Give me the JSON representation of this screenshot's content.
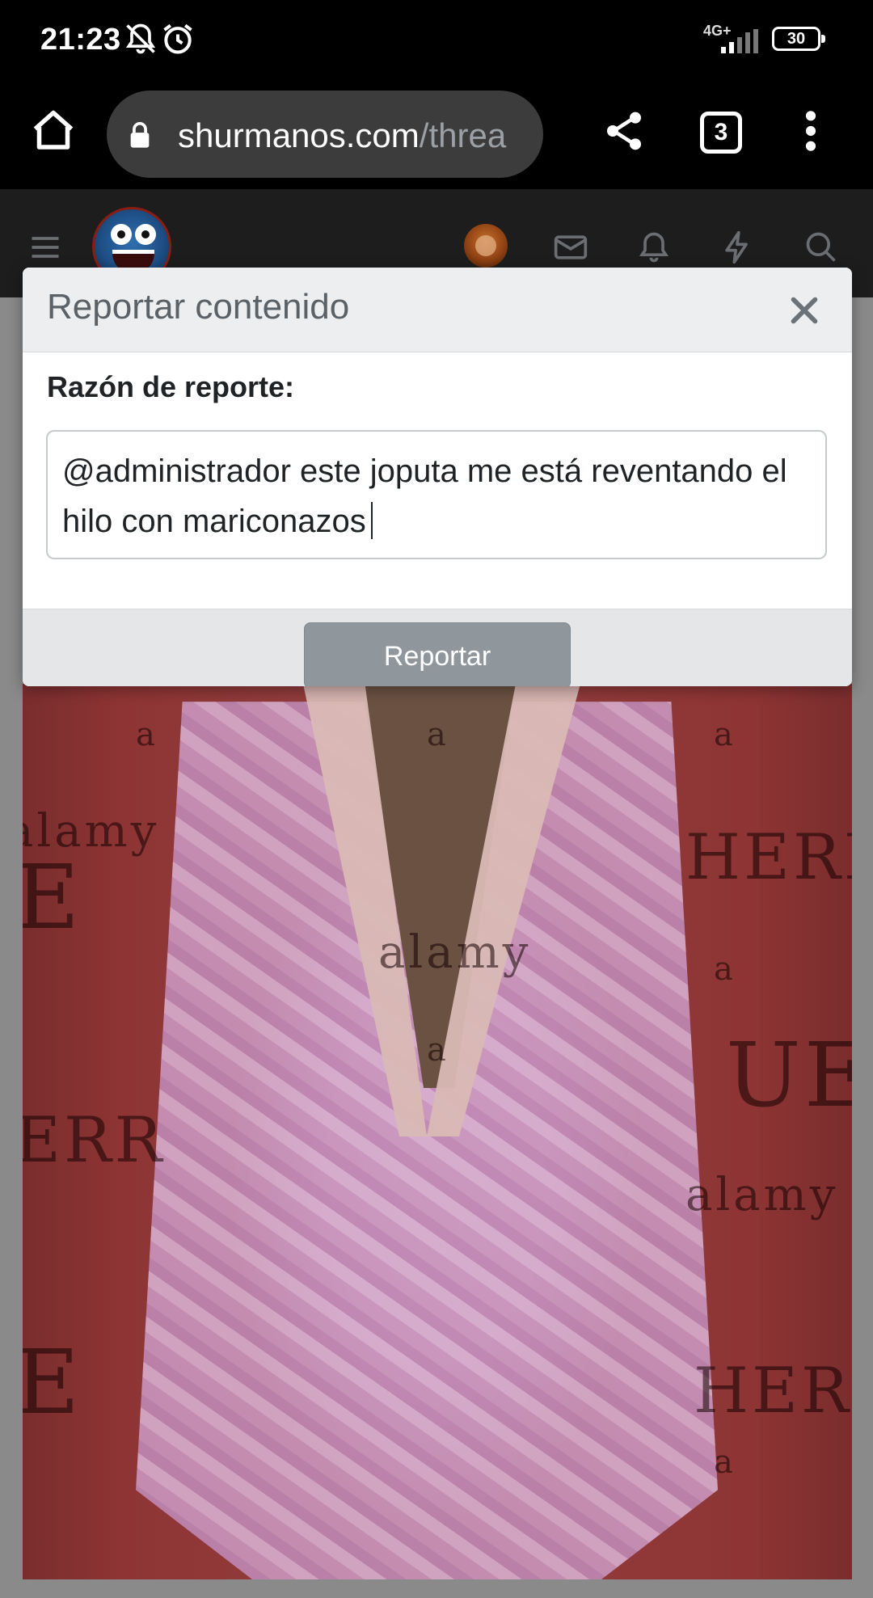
{
  "status_bar": {
    "time": "21:23",
    "network": "4G+",
    "battery": "30",
    "icons": [
      "bell-muted-icon",
      "alarm-icon",
      "signal-icon",
      "battery-icon"
    ]
  },
  "browser": {
    "url_host": "shurmanos.com",
    "url_path": "/threa",
    "tab_count": "3",
    "icons": [
      "home-icon",
      "lock-icon",
      "share-icon",
      "tabs-icon",
      "more-vert-icon"
    ]
  },
  "site_nav": {
    "icons": [
      "hamburger-icon",
      "site-logo",
      "user-avatar",
      "mail-icon",
      "bell-icon",
      "lightning-icon",
      "search-icon"
    ]
  },
  "modal": {
    "title": "Reportar contenido",
    "reason_label": "Razón de reporte:",
    "reason_text": "@administrador este joputa me está reventando el hilo con mariconazos",
    "submit_label": "Reportar",
    "close_icon": "close-icon"
  },
  "post_image": {
    "watermarks": [
      "a",
      "a",
      "a",
      "alamy",
      "alamy",
      "alamy",
      "HERR",
      "ERR",
      "UE",
      "E",
      "HERR",
      "E",
      "a",
      "a",
      "a"
    ]
  },
  "colors": {
    "browser_bg": "#000000",
    "url_bar_bg": "#3c3c3c",
    "site_nav_bg": "#1d1d1d",
    "modal_header_bg": "#eceeef",
    "button_bg": "#8f979c"
  }
}
